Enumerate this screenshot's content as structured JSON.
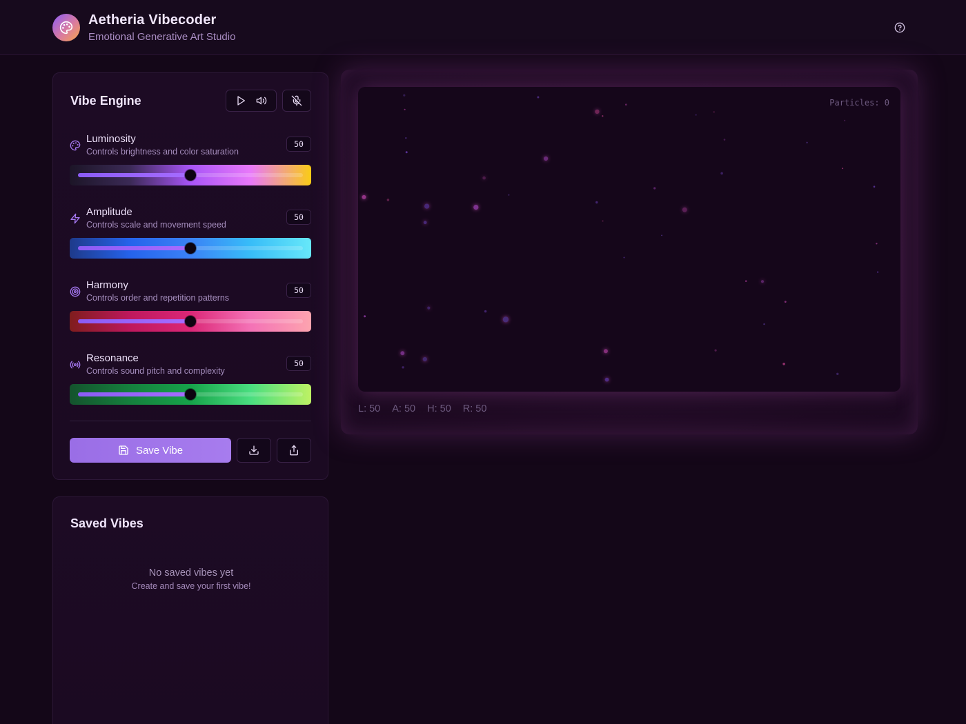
{
  "app": {
    "title": "Aetheria Vibecoder",
    "subtitle": "Emotional Generative Art Studio",
    "logo_icon": "palette-icon",
    "help_icon": "help-circle-icon"
  },
  "engine": {
    "title": "Vibe Engine",
    "controls": {
      "play_icon": "play-icon",
      "sound_icon": "volume-icon",
      "mic_icon": "mic-off-icon"
    },
    "sliders": [
      {
        "label": "Luminosity",
        "description": "Controls brightness and color saturation",
        "value": "50",
        "level": 50,
        "icon": "palette-icon",
        "gradient": [
          "#1c1527",
          "#3b2a56",
          "#a855f7",
          "#e879f9",
          "#facc15"
        ]
      },
      {
        "label": "Amplitude",
        "description": "Controls scale and movement speed",
        "value": "50",
        "level": 50,
        "icon": "zap-icon",
        "gradient": [
          "#1e3a8a",
          "#2563eb",
          "#3b82f6",
          "#38bdf8",
          "#67e8f9"
        ]
      },
      {
        "label": "Harmony",
        "description": "Controls order and repetition patterns",
        "value": "50",
        "level": 50,
        "icon": "target-icon",
        "gradient": [
          "#7f1d1d",
          "#be185d",
          "#db2777",
          "#f472b6",
          "#fda4af"
        ]
      },
      {
        "label": "Resonance",
        "description": "Controls sound pitch and complexity",
        "value": "50",
        "level": 50,
        "icon": "radio-icon",
        "gradient": [
          "#14532d",
          "#15803d",
          "#16a34a",
          "#4ade80",
          "#bef264"
        ]
      }
    ],
    "save_label": "Save Vibe",
    "save_icon": "save-icon",
    "download_icon": "download-icon",
    "share_icon": "share-icon"
  },
  "saved": {
    "title": "Saved Vibes",
    "empty_title": "No saved vibes yet",
    "empty_subtitle": "Create and save your first vibe!"
  },
  "canvas": {
    "particles_label": "Particles: 0",
    "stats": [
      "L: 50",
      "A: 50",
      "H: 50",
      "R: 50"
    ]
  },
  "colors": {
    "accent": "#9b6fe6",
    "background": "#140718",
    "panel": "#1d0b24"
  }
}
